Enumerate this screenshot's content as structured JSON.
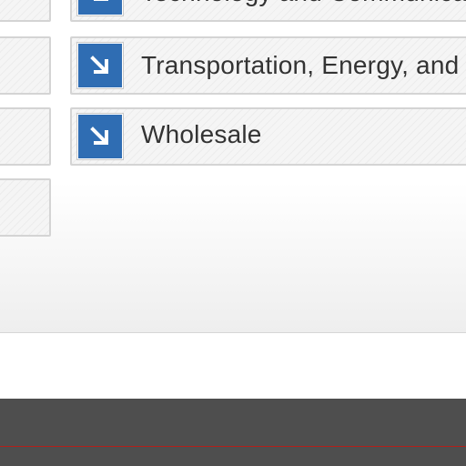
{
  "categories": [
    {
      "label": "Technology and Communications",
      "icon": "arrow-down-right-icon"
    },
    {
      "label": "Transportation, Energy, and Utilities",
      "icon": "arrow-down-right-icon"
    },
    {
      "label": "Wholesale",
      "icon": "arrow-down-right-icon"
    }
  ],
  "colors": {
    "icon_bg": "#2f6db3",
    "footer_bg": "#4e4e4e",
    "footer_rule": "#b3201a",
    "text": "#333333"
  }
}
